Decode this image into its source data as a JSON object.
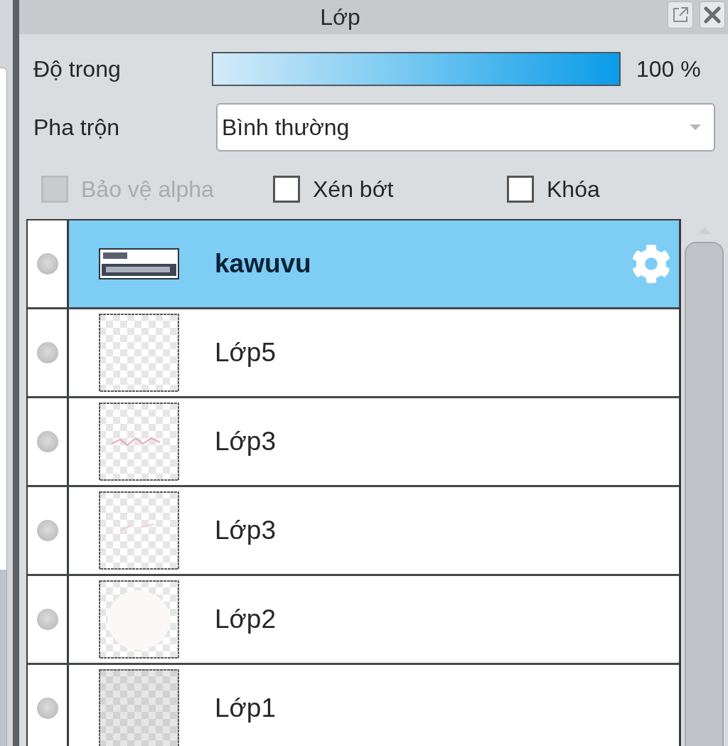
{
  "panel": {
    "title": "Lớp"
  },
  "opacity": {
    "label": "Độ trong",
    "level": 1,
    "reading": "100 %"
  },
  "blend_mode": {
    "label": "Pha trộn",
    "value": "Bình thường"
  },
  "options": [
    {
      "label": "Bảo vệ alpha",
      "checked": false,
      "disabled": true
    },
    {
      "label": "Xén bớt",
      "checked": false,
      "disabled": false
    },
    {
      "label": "Khóa",
      "checked": false,
      "disabled": false
    }
  ],
  "layers": [
    {
      "name": "kawuvu",
      "kind": "text",
      "selected": true
    },
    {
      "name": "Lớp5",
      "kind": "blank",
      "selected": false
    },
    {
      "name": "Lớp3",
      "kind": "sketch",
      "selected": false
    },
    {
      "name": "Lớp3",
      "kind": "faint",
      "selected": false
    },
    {
      "name": "Lớp2",
      "kind": "blob",
      "selected": false
    },
    {
      "name": "Lớp1",
      "kind": "shaded",
      "selected": false
    }
  ]
}
